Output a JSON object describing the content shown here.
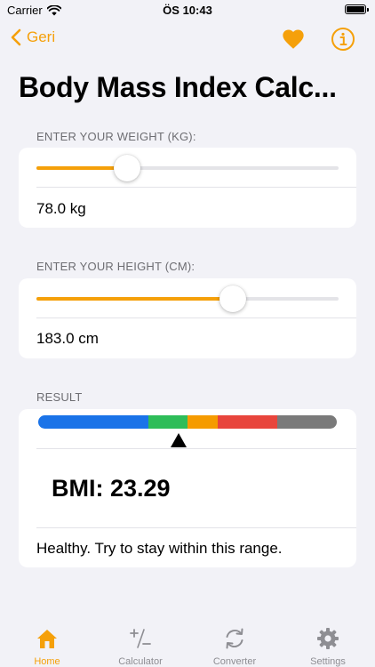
{
  "status_bar": {
    "carrier": "Carrier",
    "time": "ÖS 10:43"
  },
  "nav": {
    "back_label": "Geri"
  },
  "title": "Body Mass Index Calc...",
  "weight": {
    "header": "ENTER YOUR WEIGHT (KG):",
    "value_text": "78.0 kg",
    "slider_fraction": 0.3
  },
  "height": {
    "header": "ENTER YOUR HEIGHT (CM):",
    "value_text": "183.0 cm",
    "slider_fraction": 0.65
  },
  "result": {
    "header": "RESULT",
    "bmi_text": "BMI: 23.29",
    "status_text": "Healthy. Try to stay within this range.",
    "scale_segments": [
      {
        "color": "#1a73e8",
        "share": 0.37
      },
      {
        "color": "#2ebd59",
        "share": 0.13
      },
      {
        "color": "#f59b00",
        "share": 0.1
      },
      {
        "color": "#e8453c",
        "share": 0.2
      },
      {
        "color": "#7a7a7a",
        "share": 0.2
      }
    ],
    "pointer_fraction": 0.47
  },
  "tabs": [
    {
      "label": "Home",
      "icon": "home-icon",
      "active": true
    },
    {
      "label": "Calculator",
      "icon": "plus-minus-icon",
      "active": false
    },
    {
      "label": "Converter",
      "icon": "refresh-icon",
      "active": false
    },
    {
      "label": "Settings",
      "icon": "gear-icon",
      "active": false
    }
  ],
  "colors": {
    "accent": "#f5a00a",
    "background": "#f2f2f7",
    "card": "#ffffff",
    "muted_text": "#6d6d72",
    "tab_inactive": "#8e8e93"
  }
}
